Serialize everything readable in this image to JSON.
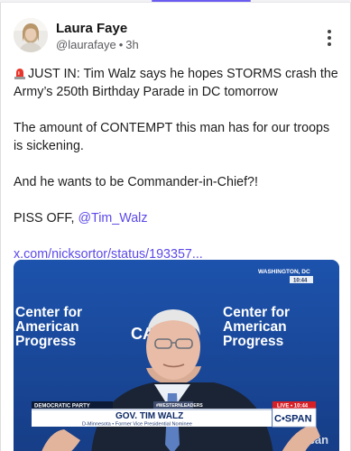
{
  "post": {
    "author_name": "Laura Faye",
    "author_handle": "@laurafaye",
    "separator": "•",
    "age": "3h",
    "paragraphs": {
      "p1_text": "JUST IN: Tim Walz says he hopes STORMS crash the Army’s 250th Birthday Parade in DC tomorrow",
      "p2": "The amount of CONTEMPT this man has for our troops is sickening.",
      "p3": "And he wants to be Commander-in-Chief?!",
      "p4_prefix": "PISS OFF, ",
      "p4_mention": "@Tim_Walz"
    },
    "link_text": "x.com/nicksortor/status/193357..."
  },
  "media": {
    "backdrop_left": "Center for\nAmerican\nProgress",
    "backdrop_right": "Center for\nAmerican\nProgress",
    "backdrop_fragment": "CA",
    "location": "WASHINGTON, DC",
    "clock": "10:44",
    "party_tag": "DEMOCRATIC PARTY",
    "hashtag": "#WESTERNLEADERS",
    "speaker_name": "GOV. TIM WALZ",
    "speaker_subtitle": "D-Minnesota  •  Former Vice Presidential Nominee",
    "live_label": "LIVE • 10:44",
    "network": "C•SPAN",
    "lower_fragment": "rican"
  },
  "colors": {
    "accent": "#5b49e8",
    "backdrop_blue": "#1d53ad",
    "live_red": "#d71f26"
  },
  "icons": {
    "siren": "police-siren",
    "more": "vertical-ellipsis"
  }
}
